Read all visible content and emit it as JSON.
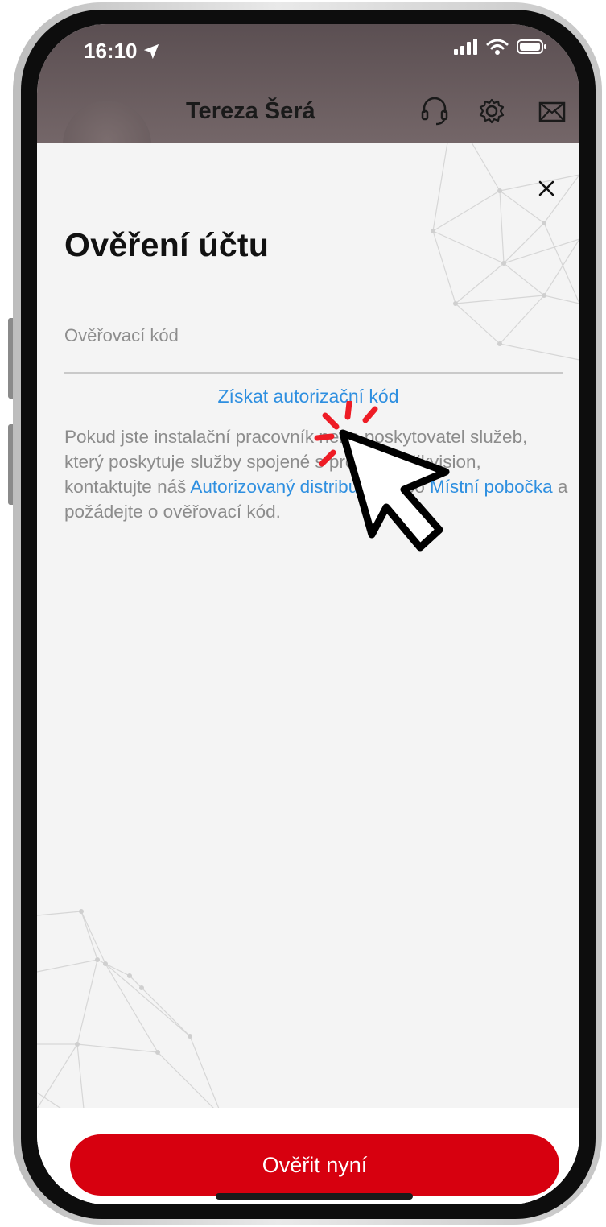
{
  "status_bar": {
    "time": "16:10"
  },
  "header": {
    "title": "Tereza Šerá"
  },
  "modal": {
    "title": "Ověření účtu",
    "input_placeholder": "Ověřovací kód",
    "get_code_link": "Získat autorizační kód",
    "info": {
      "part1": "Pokud jste instalační pracovník nebo poskytovatel služeb, který poskytuje služby spojené s produkty Hikvision, kontaktujte náš ",
      "link1": "Autorizovaný distributor",
      "part2": " nebo ",
      "link2": "Místní pobočka",
      "part3": " a požádejte o ověřovací kód."
    },
    "verify_button": "Ověřit nyní"
  },
  "icons": [
    "location-arrow-icon",
    "signal-icon",
    "wifi-icon",
    "battery-icon",
    "headset-icon",
    "gear-icon",
    "mail-icon",
    "close-icon",
    "click-cursor-icon"
  ],
  "colors": {
    "accent": "#d7000f",
    "link": "#2e8fe0"
  }
}
